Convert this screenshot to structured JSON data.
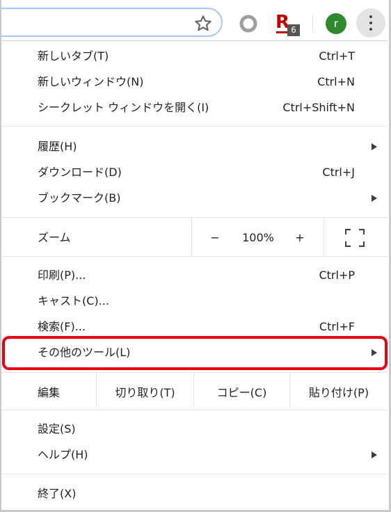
{
  "toolbar": {
    "extension_badge": "6",
    "rakuten_letter": "R",
    "avatar_letter": "r"
  },
  "menu": {
    "new_tab": {
      "label": "新しいタブ(T)",
      "shortcut": "Ctrl+T"
    },
    "new_window": {
      "label": "新しいウィンドウ(N)",
      "shortcut": "Ctrl+N"
    },
    "incognito": {
      "label": "シークレット ウィンドウを開く(I)",
      "shortcut": "Ctrl+Shift+N"
    },
    "history": {
      "label": "履歴(H)"
    },
    "downloads": {
      "label": "ダウンロード(D)",
      "shortcut": "Ctrl+J"
    },
    "bookmarks": {
      "label": "ブックマーク(B)"
    },
    "zoom": {
      "label": "ズーム",
      "minus": "−",
      "value": "100%",
      "plus": "+"
    },
    "print": {
      "label": "印刷(P)...",
      "shortcut": "Ctrl+P"
    },
    "cast": {
      "label": "キャスト(C)..."
    },
    "find": {
      "label": "検索(F)...",
      "shortcut": "Ctrl+F"
    },
    "more_tools": {
      "label": "その他のツール(L)"
    },
    "edit": {
      "label": "編集",
      "cut": "切り取り(T)",
      "copy": "コピー(C)",
      "paste": "貼り付け(P)"
    },
    "settings": {
      "label": "設定(S)"
    },
    "help": {
      "label": "ヘルプ(H)"
    },
    "exit": {
      "label": "終了(X)"
    }
  },
  "colors": {
    "highlight": "#e60012",
    "rakuten": "#bf0000",
    "avatar": "#2e8a2e"
  }
}
